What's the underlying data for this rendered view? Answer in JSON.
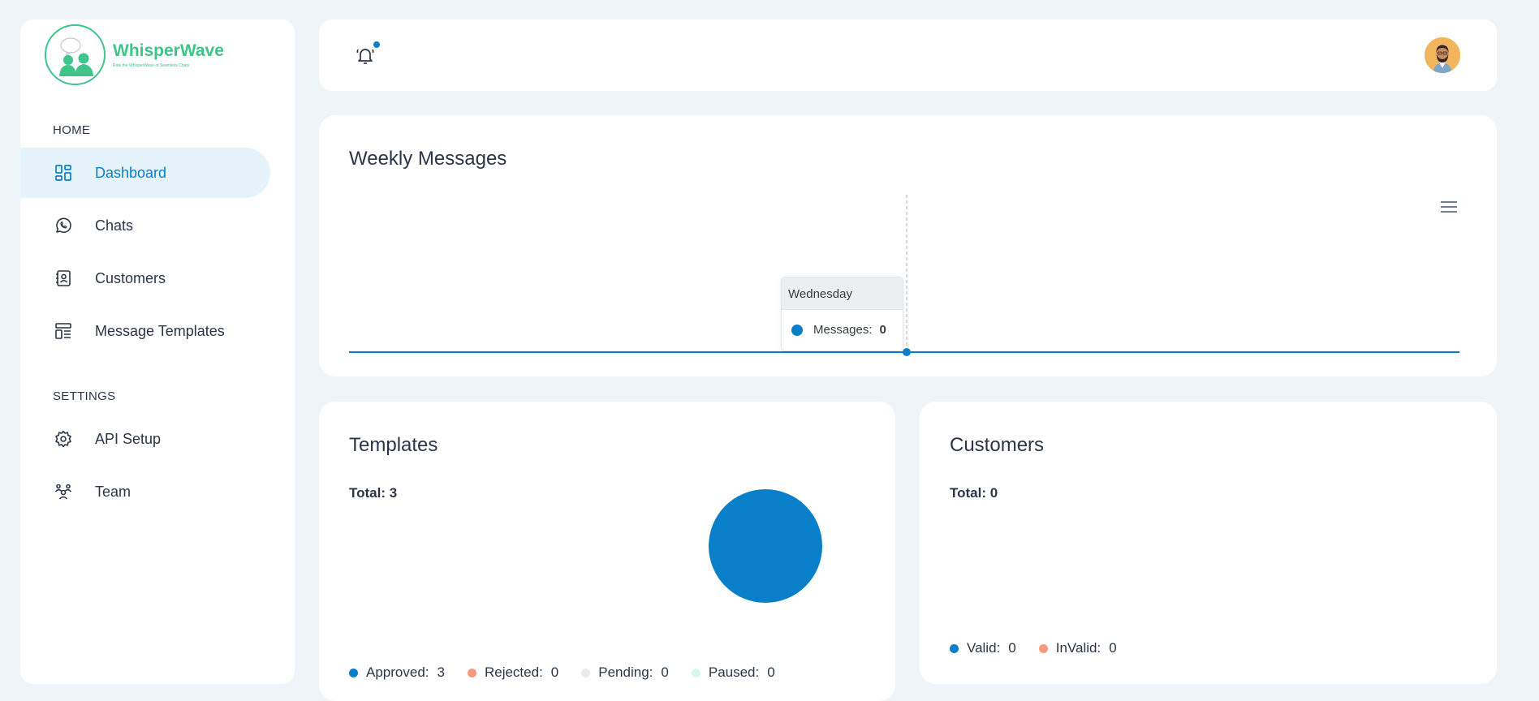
{
  "brand": {
    "name": "WhisperWave",
    "tagline": "Ride the WhisperWave of Seamless Chats",
    "accent": "#3fc48a"
  },
  "sidebar": {
    "home_title": "HOME",
    "settings_title": "SETTINGS",
    "home_items": [
      {
        "label": "Dashboard",
        "icon": "dashboard-icon",
        "active": true
      },
      {
        "label": "Chats",
        "icon": "whatsapp-icon"
      },
      {
        "label": "Customers",
        "icon": "contacts-icon"
      },
      {
        "label": "Message Templates",
        "icon": "template-icon"
      }
    ],
    "settings_items": [
      {
        "label": "API Setup",
        "icon": "gear-icon"
      },
      {
        "label": "Team",
        "icon": "team-icon"
      }
    ]
  },
  "header": {
    "notification_icon": "bell-icon",
    "has_notification": true,
    "avatar": "user-avatar"
  },
  "weekly_messages": {
    "title": "Weekly Messages",
    "menu_icon": "hamburger-menu-icon",
    "tooltip": {
      "day": "Wednesday",
      "series": "Messages:",
      "value": "0"
    }
  },
  "templates": {
    "title": "Templates",
    "total": "Total: 3",
    "legend": [
      {
        "label": "Approved:",
        "value": "3",
        "color": "#0a7fc9"
      },
      {
        "label": "Rejected:",
        "value": "0",
        "color": "#f59a7f"
      },
      {
        "label": "Pending:",
        "value": "0",
        "color": "#e8ecef"
      },
      {
        "label": "Paused:",
        "value": "0",
        "color": "#d8f7ee"
      }
    ]
  },
  "customers": {
    "title": "Customers",
    "total": "Total: 0",
    "legend": [
      {
        "label": "Valid:",
        "value": "0",
        "color": "#0a7fc9"
      },
      {
        "label": "InValid:",
        "value": "0",
        "color": "#f59a7f"
      }
    ]
  },
  "chart_data": [
    {
      "type": "line",
      "title": "Weekly Messages",
      "series": [
        {
          "name": "Messages",
          "values": [
            0,
            0,
            0,
            0,
            0,
            0,
            0
          ]
        }
      ],
      "highlighted_point": {
        "x": "Wednesday",
        "y": 0
      },
      "color": "#0a7fc9"
    },
    {
      "type": "pie",
      "title": "Templates",
      "categories": [
        "Approved",
        "Rejected",
        "Pending",
        "Paused"
      ],
      "values": [
        3,
        0,
        0,
        0
      ]
    },
    {
      "type": "pie",
      "title": "Customers",
      "categories": [
        "Valid",
        "InValid"
      ],
      "values": [
        0,
        0
      ]
    }
  ]
}
